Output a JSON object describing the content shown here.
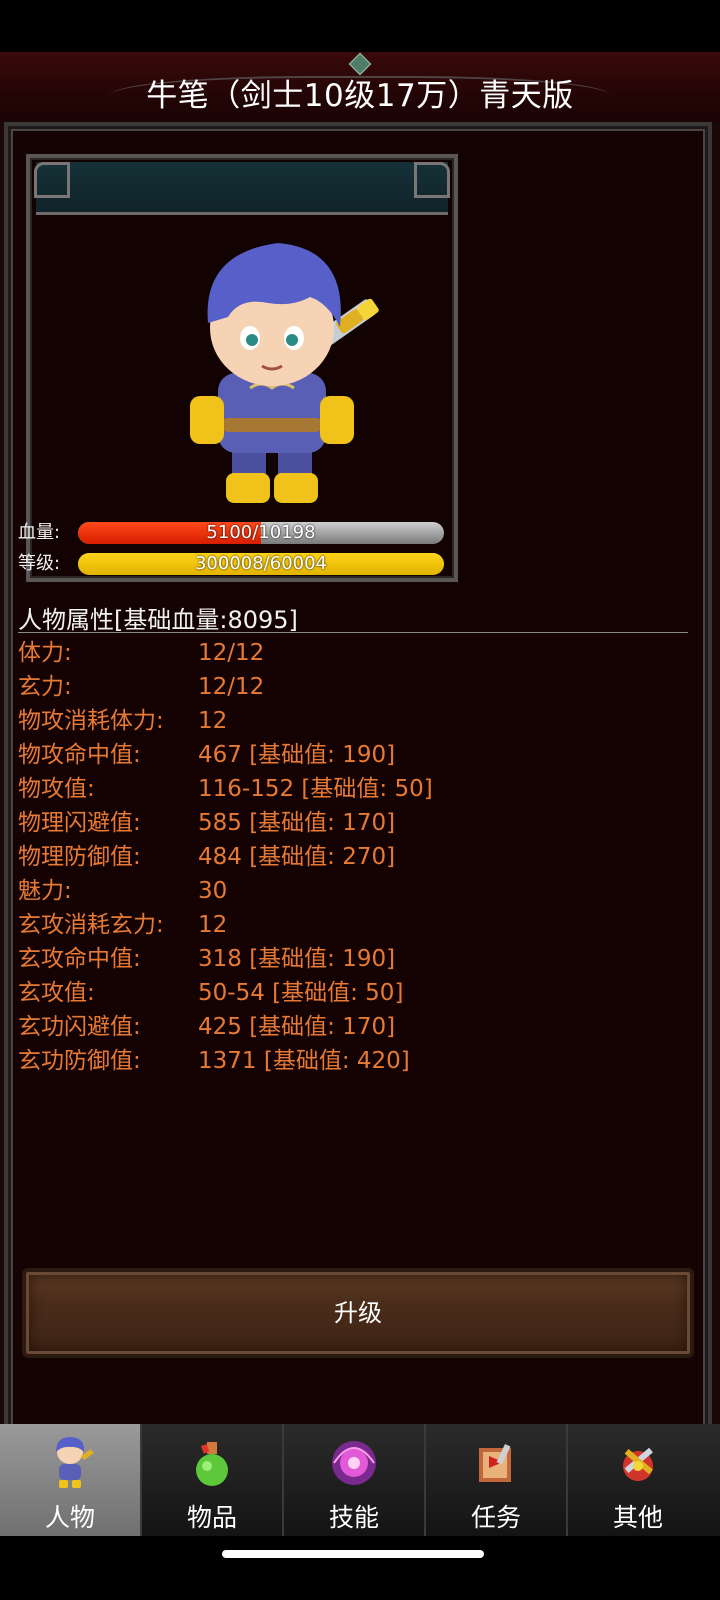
{
  "title": "牛笔（剑士10级17万）青天版",
  "character": {
    "hp_label": "血量:",
    "hp_text": "5100/10198",
    "hp_fraction": 0.5,
    "level_label": "等级:",
    "level_text": "300008/60004",
    "level_fraction": 1.0
  },
  "attributes": {
    "title": "人物属性[基础血量:8095]",
    "rows": [
      {
        "label": "体力:",
        "value": "12/12"
      },
      {
        "label": "玄力:",
        "value": "12/12"
      },
      {
        "label": "物攻消耗体力:",
        "value": "12"
      },
      {
        "label": "物攻命中值:",
        "value": "467 [基础值: 190]"
      },
      {
        "label": "物攻值:",
        "value": "116-152 [基础值: 50]"
      },
      {
        "label": "物理闪避值:",
        "value": "585 [基础值: 170]"
      },
      {
        "label": "物理防御值:",
        "value": "484 [基础值: 270]"
      },
      {
        "label": "魅力:",
        "value": "30"
      },
      {
        "label": "玄攻消耗玄力:",
        "value": "12"
      },
      {
        "label": "玄攻命中值:",
        "value": "318 [基础值: 190]"
      },
      {
        "label": "玄攻值:",
        "value": "50-54 [基础值: 50]"
      },
      {
        "label": "玄功闪避值:",
        "value": "425 [基础值: 170]"
      },
      {
        "label": "玄功防御值:",
        "value": "1371 [基础值: 420]"
      }
    ]
  },
  "upgrade_label": "升级",
  "tabs": [
    {
      "label": "人物",
      "icon": "character-icon",
      "active": true
    },
    {
      "label": "物品",
      "icon": "potion-icon",
      "active": false
    },
    {
      "label": "技能",
      "icon": "skill-orb-icon",
      "active": false
    },
    {
      "label": "任务",
      "icon": "quest-icon",
      "active": false
    },
    {
      "label": "其他",
      "icon": "settings-icon",
      "active": false
    }
  ],
  "colors": {
    "attribute_text": "#e67a35",
    "hp_bar": "#e02a08",
    "level_bar": "#f0c000"
  }
}
